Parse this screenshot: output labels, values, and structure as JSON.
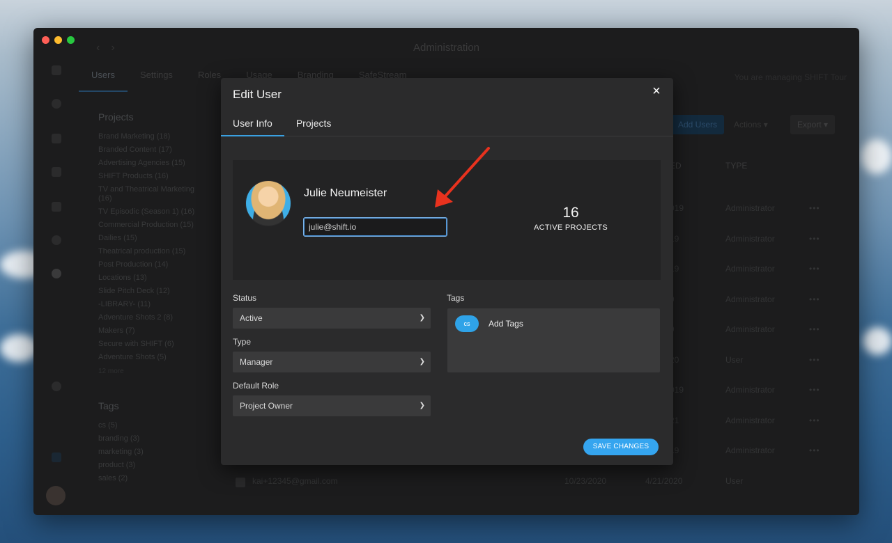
{
  "window": {
    "title": "Administration",
    "tabs": [
      "Users",
      "Settings",
      "Roles",
      "Usage",
      "Branding",
      "SafeStream"
    ],
    "managing_text": "You are managing SHIFT Tour"
  },
  "sidebar": {
    "projects_heading": "Projects",
    "projects": [
      "Brand Marketing (18)",
      "Branded Content (17)",
      "Advertising Agencies (15)",
      "SHIFT Products (16)",
      "TV and Theatrical Marketing (16)",
      "TV Episodic (Season 1) (16)",
      "Commercial Production (15)",
      "Dailies (15)",
      "Theatrical production (15)",
      "Post Production (14)",
      "Locations (13)",
      "Slide Pitch Deck (12)",
      "-LIBRARY- (11)",
      "Adventure Shots 2 (8)",
      "Makers (7)",
      "Secure with SHIFT (6)",
      "Adventure Shots (5)"
    ],
    "more_label": "12 more",
    "tags_heading": "Tags",
    "tags": [
      "cs (5)",
      "branding (3)",
      "marketing (3)",
      "product (3)",
      "sales (2)"
    ]
  },
  "toolbar": {
    "add_users": "Add Users",
    "actions": "Actions",
    "export": "Export"
  },
  "table": {
    "col_d": "ED",
    "col_type": "TYPE",
    "rows": [
      {
        "date": "019",
        "type": "Administrator"
      },
      {
        "date": "19",
        "type": "Administrator"
      },
      {
        "date": "19",
        "type": "Administrator"
      },
      {
        "date": "9",
        "type": "Administrator"
      },
      {
        "date": "9",
        "type": "Administrator"
      },
      {
        "date": "20",
        "type": "User"
      },
      {
        "date": "019",
        "type": "Administrator"
      },
      {
        "date": "21",
        "type": "Administrator"
      },
      {
        "date": "19",
        "type": "Administrator"
      }
    ],
    "last_row": {
      "email": "kai+12345@gmail.com",
      "created": "10/23/2020",
      "date": "4/21/2020",
      "type": "User"
    }
  },
  "modal": {
    "title": "Edit User",
    "close_icon": "×",
    "tabs": [
      "User Info",
      "Projects"
    ],
    "user_name": "Julie Neumeister",
    "email_value": "julie@shift.io",
    "active_projects_count": "16",
    "active_projects_label": "ACTIVE PROJECTS",
    "status_label": "Status",
    "status_value": "Active",
    "type_label": "Type",
    "type_value": "Manager",
    "role_label": "Default Role",
    "role_value": "Project Owner",
    "tags_label": "Tags",
    "tag_chip": "cs",
    "add_tags": "Add Tags",
    "save_label": "SAVE CHANGES"
  },
  "colors": {
    "accent": "#35a5ef",
    "annotation_arrow": "#e8321e"
  }
}
